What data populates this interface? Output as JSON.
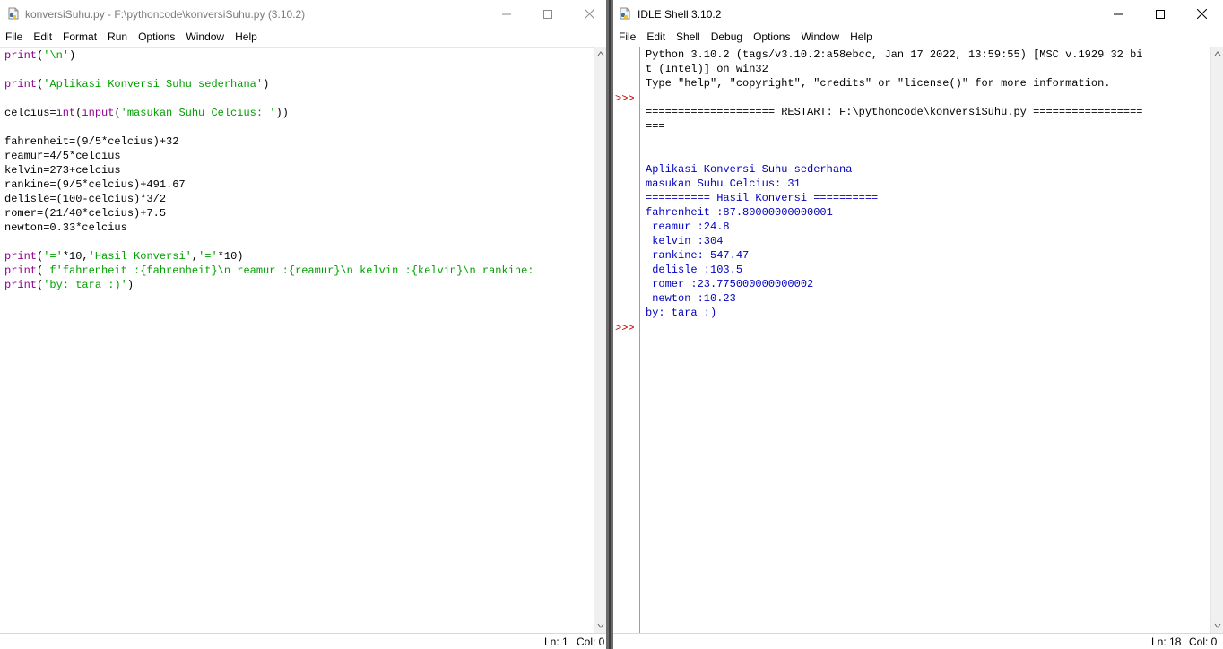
{
  "editor": {
    "title": "konversiSuhu.py - F:\\pythoncode\\konversiSuhu.py (3.10.2)",
    "menu": [
      "File",
      "Edit",
      "Format",
      "Run",
      "Options",
      "Window",
      "Help"
    ],
    "code_lines": [
      [
        {
          "t": "print",
          "c": "kw"
        },
        {
          "t": "(",
          "c": "bl"
        },
        {
          "t": "'\\n'",
          "c": "st"
        },
        {
          "t": ")",
          "c": "bl"
        }
      ],
      [],
      [
        {
          "t": "print",
          "c": "kw"
        },
        {
          "t": "(",
          "c": "bl"
        },
        {
          "t": "'Aplikasi Konversi Suhu sederhana'",
          "c": "st"
        },
        {
          "t": ")",
          "c": "bl"
        }
      ],
      [],
      [
        {
          "t": "celcius=",
          "c": "bl"
        },
        {
          "t": "int",
          "c": "kw"
        },
        {
          "t": "(",
          "c": "bl"
        },
        {
          "t": "input",
          "c": "kw"
        },
        {
          "t": "(",
          "c": "bl"
        },
        {
          "t": "'masukan Suhu Celcius: '",
          "c": "st"
        },
        {
          "t": "))",
          "c": "bl"
        }
      ],
      [],
      [
        {
          "t": "fahrenheit=(9/5*celcius)+32",
          "c": "bl"
        }
      ],
      [
        {
          "t": "reamur=4/5*celcius",
          "c": "bl"
        }
      ],
      [
        {
          "t": "kelvin=273+celcius",
          "c": "bl"
        }
      ],
      [
        {
          "t": "rankine=(9/5*celcius)+491.67",
          "c": "bl"
        }
      ],
      [
        {
          "t": "delisle=(100-celcius)*3/2",
          "c": "bl"
        }
      ],
      [
        {
          "t": "romer=(21/40*celcius)+7.5",
          "c": "bl"
        }
      ],
      [
        {
          "t": "newton=0.33*celcius",
          "c": "bl"
        }
      ],
      [],
      [
        {
          "t": "print",
          "c": "kw"
        },
        {
          "t": "(",
          "c": "bl"
        },
        {
          "t": "'='",
          "c": "st"
        },
        {
          "t": "*10,",
          "c": "bl"
        },
        {
          "t": "'Hasil Konversi'",
          "c": "st"
        },
        {
          "t": ",",
          "c": "bl"
        },
        {
          "t": "'='",
          "c": "st"
        },
        {
          "t": "*10)",
          "c": "bl"
        }
      ],
      [
        {
          "t": "print",
          "c": "kw"
        },
        {
          "t": "( ",
          "c": "bl"
        },
        {
          "t": "f'fahrenheit :{fahrenheit}\\n reamur :{reamur}\\n kelvin :{kelvin}\\n rankine:",
          "c": "st"
        }
      ],
      [
        {
          "t": "print",
          "c": "kw"
        },
        {
          "t": "(",
          "c": "bl"
        },
        {
          "t": "'by: tara :)'",
          "c": "st"
        },
        {
          "t": ")",
          "c": "bl"
        }
      ]
    ],
    "status": {
      "line": "Ln: 1",
      "col": "Col: 0"
    }
  },
  "shell": {
    "title": "IDLE Shell 3.10.2",
    "menu": [
      "File",
      "Edit",
      "Shell",
      "Debug",
      "Options",
      "Window",
      "Help"
    ],
    "prompt": ">>>",
    "lines": [
      {
        "t": "Python 3.10.2 (tags/v3.10.2:a58ebcc, Jan 17 2022, 13:59:55) [MSC v.1929 32 bi",
        "c": "bl"
      },
      {
        "t": "t (Intel)] on win32",
        "c": "bl"
      },
      {
        "t": "Type \"help\", \"copyright\", \"credits\" or \"license()\" for more information.",
        "c": "bl"
      },
      {
        "t": "",
        "c": "bl"
      },
      {
        "t": "==================== RESTART: F:\\pythoncode\\konversiSuhu.py =================",
        "c": "bl"
      },
      {
        "t": "===",
        "c": "bl"
      },
      {
        "t": "",
        "c": "bl"
      },
      {
        "t": "",
        "c": "bl"
      },
      {
        "t": "Aplikasi Konversi Suhu sederhana",
        "c": "out"
      },
      {
        "t": "masukan Suhu Celcius: 31",
        "c": "out"
      },
      {
        "t": "========== Hasil Konversi ==========",
        "c": "out"
      },
      {
        "t": "fahrenheit :87.80000000000001",
        "c": "out"
      },
      {
        "t": " reamur :24.8",
        "c": "out"
      },
      {
        "t": " kelvin :304",
        "c": "out"
      },
      {
        "t": " rankine: 547.47",
        "c": "out"
      },
      {
        "t": " delisle :103.5",
        "c": "out"
      },
      {
        "t": " romer :23.775000000000002",
        "c": "out"
      },
      {
        "t": " newton :10.23",
        "c": "out"
      },
      {
        "t": "by: tara :)",
        "c": "out"
      }
    ],
    "status": {
      "line": "Ln: 18",
      "col": "Col: 0"
    }
  },
  "colors": {
    "keyword": "#900090",
    "string": "#00a000",
    "output": "#0000c0",
    "prompt": "#c00000"
  }
}
